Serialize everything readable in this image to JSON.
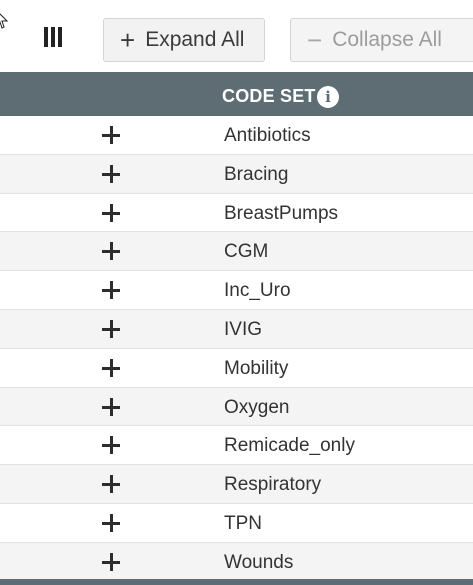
{
  "toolbar": {
    "expand_label": "Expand All",
    "collapse_label": "Collapse All",
    "expand_glyph": "+",
    "collapse_glyph": "−"
  },
  "table": {
    "header": "CODE SET",
    "info_glyph": "i",
    "expand_glyph": "+",
    "rows": [
      {
        "label": "Antibiotics"
      },
      {
        "label": "Bracing"
      },
      {
        "label": "BreastPumps"
      },
      {
        "label": "CGM"
      },
      {
        "label": "Inc_Uro"
      },
      {
        "label": "IVIG"
      },
      {
        "label": "Mobility"
      },
      {
        "label": "Oxygen"
      },
      {
        "label": "Remicade_only"
      },
      {
        "label": "Respiratory"
      },
      {
        "label": "TPN"
      },
      {
        "label": "Wounds"
      }
    ]
  },
  "icons": {
    "columns": "columns-icon",
    "cursor": "cursor-icon",
    "info": "info-icon"
  },
  "colors": {
    "header_bg": "#5e6c74",
    "row_alt_bg": "#f4f4f4"
  }
}
